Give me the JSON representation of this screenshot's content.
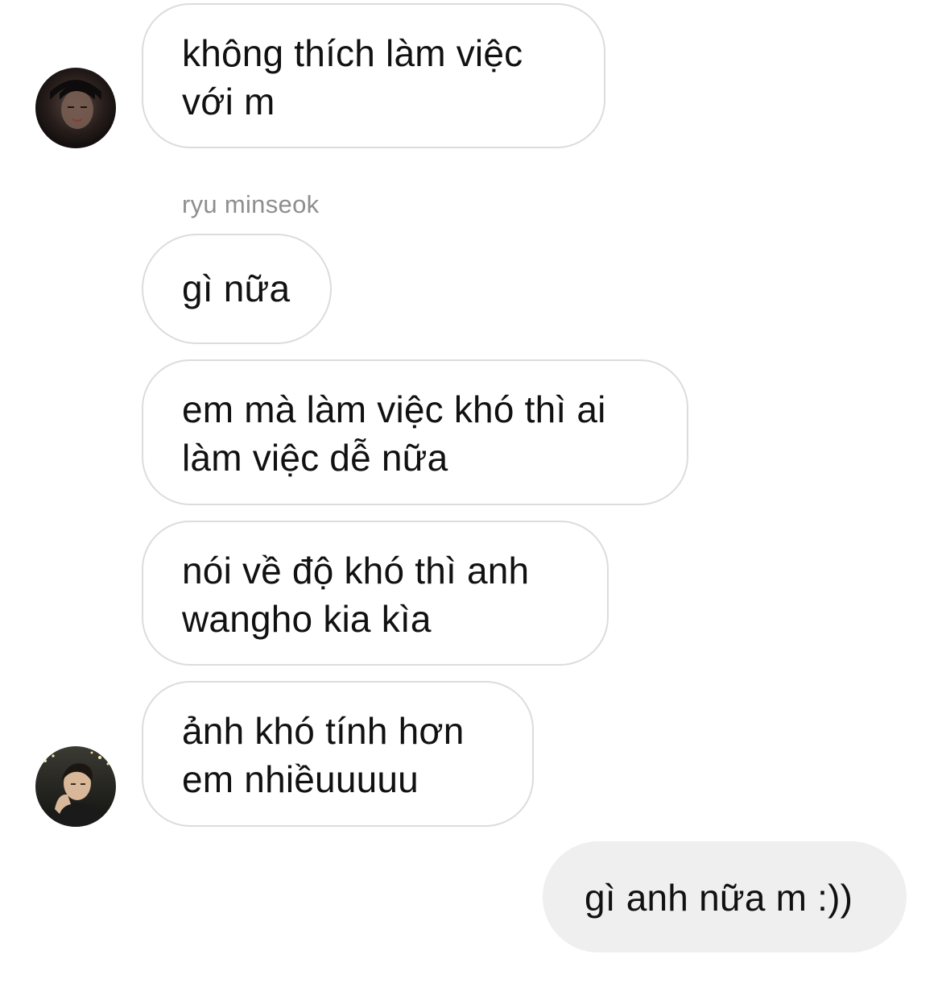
{
  "thread": {
    "messages": [
      {
        "text": "không thích làm việc\nvới m"
      },
      {
        "text": "gì nữa"
      },
      {
        "text": "em mà làm việc khó thì ai\nlàm việc dễ nữa"
      },
      {
        "text": "nói về độ khó thì anh\nwangho kia kìa"
      },
      {
        "text": "ảnh khó tính hơn\nem nhiềuuuuu"
      },
      {
        "text": "gì anh nữa m :))"
      }
    ],
    "sender_name": "ryu minseok"
  },
  "colors": {
    "incoming_bubble_border": "#dcdcdc",
    "outgoing_bubble_bg": "#efefef",
    "sender_name": "#8e8e8e"
  },
  "icons": {
    "avatar_1": "profile-photo-dark",
    "avatar_2": "profile-photo-person"
  }
}
